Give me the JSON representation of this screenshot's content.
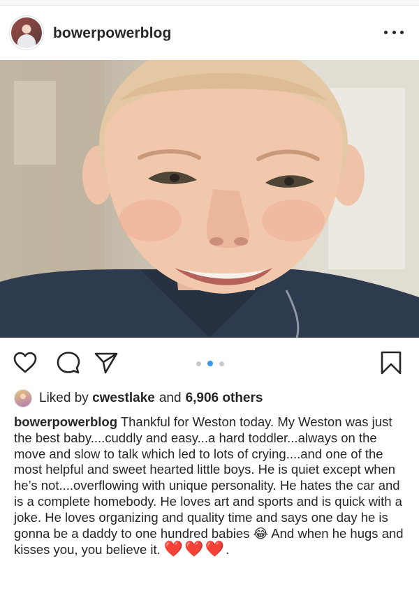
{
  "post": {
    "username": "bowerpowerblog",
    "more_label": "More options"
  },
  "photo": {
    "description_icon": "photo-of-smiling-boy",
    "carousel_count": 3,
    "carousel_active": 2
  },
  "actions": {
    "like_icon": "heart-icon",
    "comment_icon": "comment-icon",
    "share_icon": "paper-plane-icon",
    "save_icon": "bookmark-icon"
  },
  "likes": {
    "prefix": "Liked by",
    "user": "cwestlake",
    "joiner": "and",
    "others": "6,906 others"
  },
  "caption": {
    "username": "bowerpowerblog",
    "text_before_emoji": "Thankful for Weston today.  My Weston was just the best baby....cuddly and easy...a hard toddler...always on the move and slow to talk which led to lots of crying....and one of the most helpful and sweet hearted little boys.  He is quiet except when he’s not....overflowing with unique personality.  He hates the car and is a complete homebody.  He loves art and sports and is quick with a joke.  He loves organizing and quality time and says one day he is gonna be a daddy to one hundred babies",
    "emoji": "😂",
    "text_after_emoji": " And when he hugs and kisses you, you believe it. ",
    "hearts": "❤️❤️❤️",
    "end": "."
  },
  "colors": {
    "accent": "#3897f0",
    "text": "#262626",
    "heart_red": "#d8283a"
  }
}
